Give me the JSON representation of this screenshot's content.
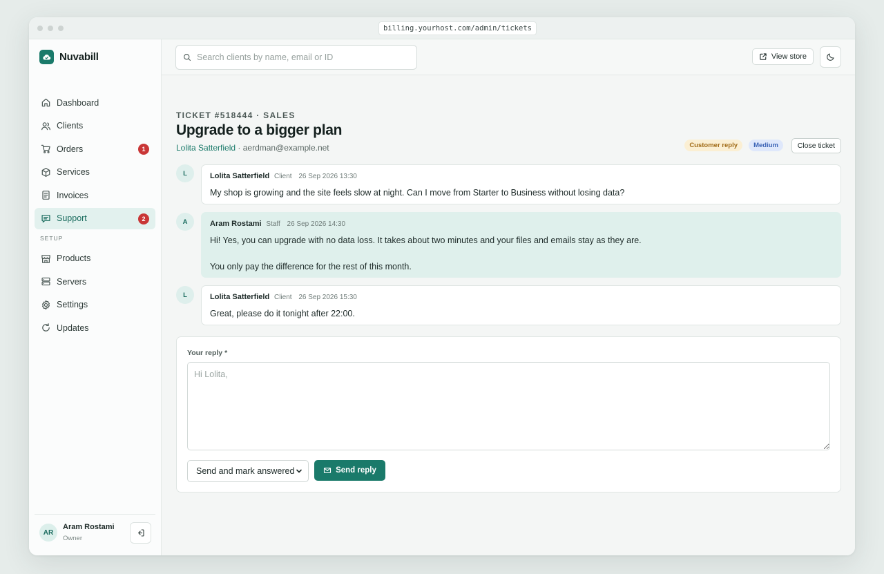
{
  "browser": {
    "url": "billing.yourhost.com/admin/tickets"
  },
  "brand": {
    "name": "Nuvabill"
  },
  "sidebar": {
    "items": [
      {
        "label": "Dashboard",
        "icon": "home-icon"
      },
      {
        "label": "Clients",
        "icon": "users-icon"
      },
      {
        "label": "Orders",
        "icon": "cart-icon",
        "badge": "1"
      },
      {
        "label": "Services",
        "icon": "box-icon"
      },
      {
        "label": "Invoices",
        "icon": "invoice-icon"
      },
      {
        "label": "Support",
        "icon": "chat-icon",
        "badge": "2",
        "active": true
      }
    ],
    "section_label": "SETUP",
    "setup_items": [
      {
        "label": "Products",
        "icon": "store-icon"
      },
      {
        "label": "Servers",
        "icon": "server-icon"
      },
      {
        "label": "Settings",
        "icon": "gear-icon"
      },
      {
        "label": "Updates",
        "icon": "refresh-icon"
      }
    ],
    "user": {
      "initials": "AR",
      "name": "Aram Rostami",
      "role": "Owner"
    }
  },
  "topbar": {
    "search_placeholder": "Search clients by name, email or ID",
    "view_store_label": "View store"
  },
  "ticket": {
    "kicker": "TICKET #518444 · SALES",
    "title": "Upgrade to a bigger plan",
    "client_name": "Lolita Satterfield",
    "client_email": " · aerdman@example.net",
    "status_tag": "Customer reply",
    "priority_tag": "Medium",
    "close_label": "Close ticket"
  },
  "messages": [
    {
      "initial": "L",
      "author": "Lolita Satterfield",
      "role": "Client",
      "time": "26 Sep 2026 13:30",
      "paragraphs": [
        "My shop is growing and the site feels slow at night. Can I move from Starter to Business without losing data?"
      ]
    },
    {
      "initial": "A",
      "author": "Aram Rostami",
      "role": "Staff",
      "time": "26 Sep 2026 14:30",
      "paragraphs": [
        "Hi! Yes, you can upgrade with no data loss. It takes about two minutes and your files and emails stay as they are.",
        "You only pay the difference for the rest of this month."
      ]
    },
    {
      "initial": "L",
      "author": "Lolita Satterfield",
      "role": "Client",
      "time": "26 Sep 2026 15:30",
      "paragraphs": [
        "Great, please do it tonight after 22:00."
      ]
    }
  ],
  "reply": {
    "label": "Your reply *",
    "placeholder": "Hi Lolita,",
    "send_mode": "Send and mark answered",
    "send_label": "Send reply"
  },
  "colors": {
    "accent": "#1a7a6a",
    "badge": "#c93636",
    "staff_bubble": "#dff0ec",
    "tag_reply_bg": "#fbefd3",
    "tag_priority_bg": "#dfe8fb"
  }
}
